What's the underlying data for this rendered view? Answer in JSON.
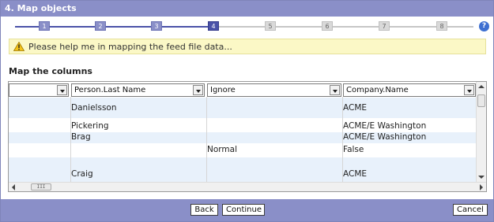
{
  "window": {
    "title": "4. Map objects"
  },
  "steps": [
    "1",
    "2",
    "3",
    "4",
    "5",
    "6",
    "7",
    "8"
  ],
  "current_step": 4,
  "help_icon": "?",
  "hint": {
    "text": "Please help me in mapping the feed file data..."
  },
  "section_label": "Map the columns",
  "grid": {
    "columns": [
      {
        "label": ""
      },
      {
        "label": "Person.Last Name"
      },
      {
        "label": "Ignore"
      },
      {
        "label": "Company.Name"
      }
    ],
    "rows": [
      {
        "cells": [
          "",
          "Danielsson",
          "",
          "ACME"
        ],
        "shaded": true
      },
      {
        "cells": [
          "",
          "Pickering",
          "",
          "ACME/E Washington"
        ],
        "shaded": false
      },
      {
        "cells": [
          "",
          "Brag",
          "",
          "ACME/E Washington"
        ],
        "shaded": true
      },
      {
        "cells": [
          "",
          "",
          "Normal",
          "False"
        ],
        "shaded": false
      },
      {
        "cells": [
          "",
          "Craig",
          "",
          "ACME"
        ],
        "shaded": true
      }
    ],
    "hscroll_thumb": "III"
  },
  "buttons": {
    "back": "Back",
    "continue": "Continue",
    "cancel": "Cancel"
  },
  "colors": {
    "titlebar": "#8a8fc8",
    "step_done": "#4a52a8",
    "hint_bg": "#fbf8c6",
    "row_shade": "#e8f1fb"
  }
}
